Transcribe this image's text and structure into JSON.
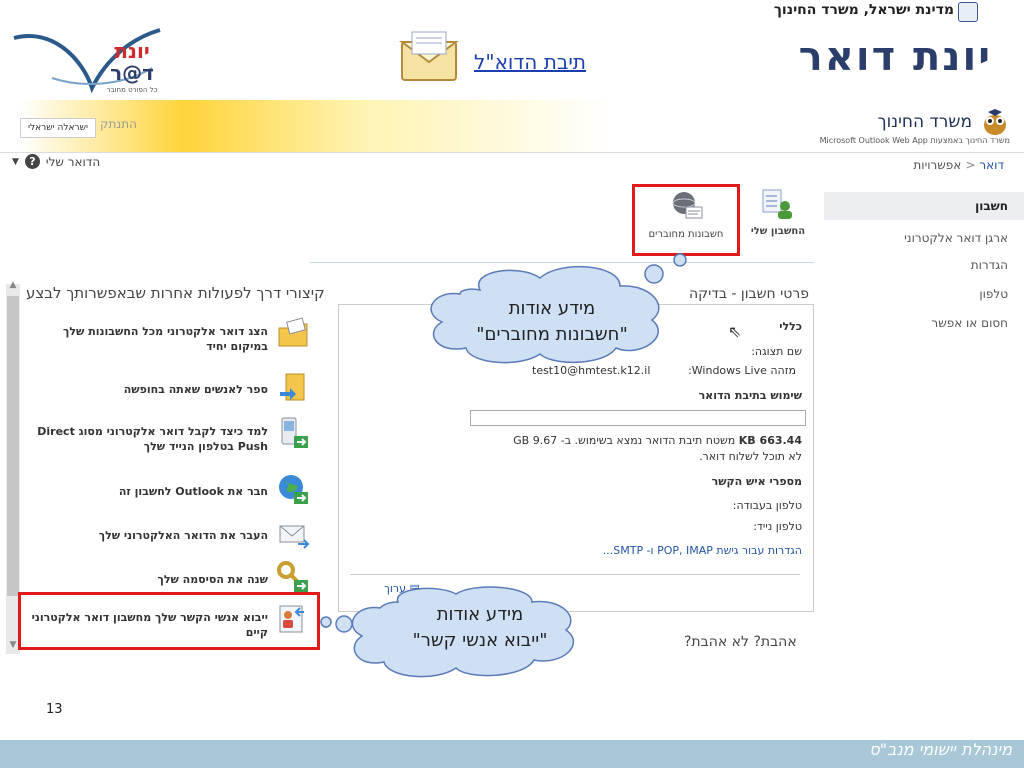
{
  "slide": {
    "gov_line": "מדינת ישראל, משרד החינוך",
    "main_title": "יונת דואר",
    "inbox_link": "תיבת הדוא\"ל",
    "logo_line1": "יונת",
    "logo_line2": "ד@ר",
    "logo_tagline": "כל הפורט מחובר",
    "page_number": "13",
    "footer_text": "מינהלת יישומי מנב\"ס"
  },
  "owa": {
    "brand_name": "משרד החינוך",
    "brand_sub": "משרד החינוך באמצעות Microsoft Outlook Web App",
    "logout": "התנתק",
    "lang_label": "ישראלה ישראלי",
    "breadcrumb_home": "דואר",
    "breadcrumb_sep": "<",
    "breadcrumb_current": "אפשרויות",
    "my_mail": "הדואר שלי",
    "help": "?"
  },
  "nav": {
    "items": [
      "חשבון",
      "ארגן דואר אלקטרוני",
      "הגדרות",
      "טלפון",
      "חסום או אפשר"
    ]
  },
  "toolbar": {
    "my_account": "החשבון שלי",
    "linked_accounts": "חשבונות מחוברים"
  },
  "details": {
    "title": "פרטי חשבון - בדיקה",
    "general": "כללי",
    "display_name_label": "שם תצוגה:",
    "live_id_label": "מזהה Windows Live:",
    "live_id_value": "test10@hmtest.k12.il",
    "mailbox_usage": "שימוש בתיבת הדואר",
    "usage_value": "663.44 KB",
    "usage_text": "משטח תיבת הדואר נמצא בשימוש. ב- 9.67 GB",
    "cannot_send": "לא תוכל לשלוח דואר.",
    "contact_numbers": "מספרי איש הקשר",
    "work_phone": "טלפון בעבודה:",
    "mobile_phone": "טלפון נייד:",
    "imap_link": "הגדרות עבור גישת POP, IMAP ו- SMTP...",
    "edit": "ערוך"
  },
  "shortcuts": {
    "title": "קיצורי דרך לפעולות אחרות שבאפשרותך לבצע",
    "items": [
      {
        "text": "הצג דואר אלקטרוני מכל החשבונות שלך במיקום יחיד"
      },
      {
        "text": "ספר לאנשים שאתה בחופשה"
      },
      {
        "text": "למד כיצד לקבל דואר אלקטרוני מסוג Direct Push בטלפון הנייד שלך"
      },
      {
        "text": "חבר את Outlook לחשבון זה"
      },
      {
        "text": "העבר את הדואר האלקטרוני שלך"
      },
      {
        "text": "שנה את הסיסמה שלך"
      },
      {
        "text": "ייבוא אנשי הקשר שלך מחשבון דואר אלקטרוני קיים"
      }
    ]
  },
  "love": {
    "title": "אהבת? לא אהבת?"
  },
  "callouts": {
    "linked_line1": "מידע אודות",
    "linked_line2": "\"חשבונות מחוברים\"",
    "import_line1": "מידע אודות",
    "import_line2": "\"ייבוא אנשי קשר\""
  },
  "colors": {
    "highlight": "#e01919",
    "cloud": "#cfe0f5",
    "title": "#2b3d6b",
    "footer": "#a8c7d7"
  }
}
